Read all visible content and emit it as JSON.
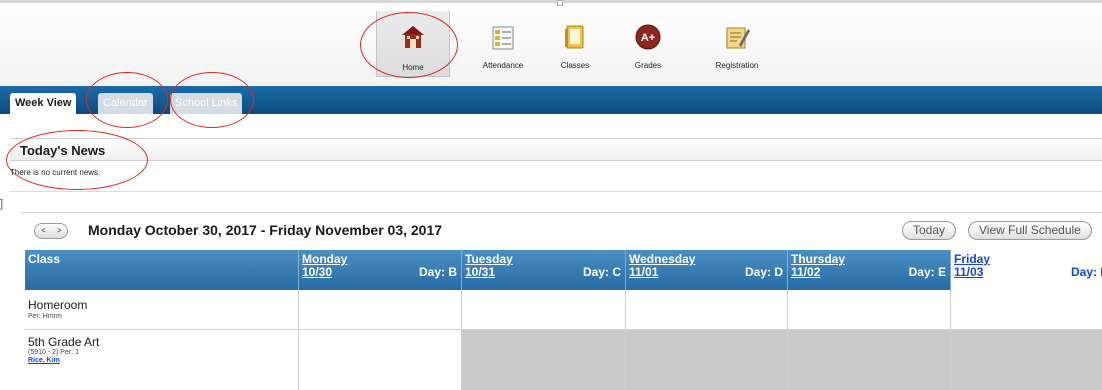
{
  "nav": {
    "items": [
      {
        "label": "Home",
        "icon": "home-icon"
      },
      {
        "label": "Attendance",
        "icon": "attendance-icon"
      },
      {
        "label": "Classes",
        "icon": "classes-icon"
      },
      {
        "label": "Grades",
        "icon": "grades-icon"
      },
      {
        "label": "Registration",
        "icon": "registration-icon"
      }
    ],
    "grades_badge": "A+"
  },
  "tabs": [
    {
      "label": "Week View"
    },
    {
      "label": "Calendar"
    },
    {
      "label": "School Links"
    }
  ],
  "news": {
    "title": "Today's News",
    "message": "There is no current news."
  },
  "schedule": {
    "range_label": "Monday October 30, 2017 - Friday November 03, 2017",
    "prev_arrow": "<",
    "next_arrow": ">",
    "today_button": "Today",
    "full_schedule_button": "View Full Schedule",
    "class_header": "Class",
    "days": [
      {
        "name": "Monday",
        "date": "10/30",
        "code": "Day: B"
      },
      {
        "name": "Tuesday",
        "date": "10/31",
        "code": "Day: C"
      },
      {
        "name": "Wednesday",
        "date": "11/01",
        "code": "Day: D"
      },
      {
        "name": "Thursday",
        "date": "11/02",
        "code": "Day: E"
      },
      {
        "name": "Friday",
        "date": "11/03",
        "code": "Day: F"
      }
    ],
    "rows": [
      {
        "name": "Homeroom",
        "detail": "Per: Hmrm",
        "teacher": ""
      },
      {
        "name": "5th Grade Art",
        "detail": "(5910 - 2) Per: 1",
        "teacher": "Rice, Kim"
      }
    ]
  },
  "colors": {
    "tab_bar": "#1a62a0",
    "grid_header": "#3a7fb6",
    "annotation": "#e0281e",
    "today_text": "#1a44d8"
  }
}
